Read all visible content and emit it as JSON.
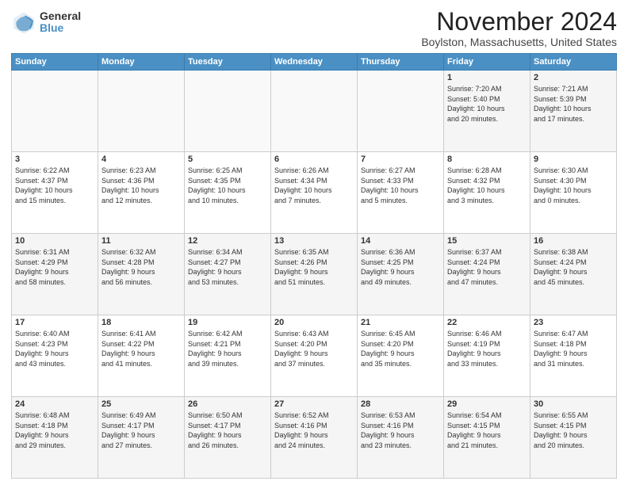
{
  "logo": {
    "general": "General",
    "blue": "Blue"
  },
  "title": "November 2024",
  "location": "Boylston, Massachusetts, United States",
  "days_header": [
    "Sunday",
    "Monday",
    "Tuesday",
    "Wednesday",
    "Thursday",
    "Friday",
    "Saturday"
  ],
  "weeks": [
    [
      {
        "day": "",
        "info": ""
      },
      {
        "day": "",
        "info": ""
      },
      {
        "day": "",
        "info": ""
      },
      {
        "day": "",
        "info": ""
      },
      {
        "day": "",
        "info": ""
      },
      {
        "day": "1",
        "info": "Sunrise: 7:20 AM\nSunset: 5:40 PM\nDaylight: 10 hours\nand 20 minutes."
      },
      {
        "day": "2",
        "info": "Sunrise: 7:21 AM\nSunset: 5:39 PM\nDaylight: 10 hours\nand 17 minutes."
      }
    ],
    [
      {
        "day": "3",
        "info": "Sunrise: 6:22 AM\nSunset: 4:37 PM\nDaylight: 10 hours\nand 15 minutes."
      },
      {
        "day": "4",
        "info": "Sunrise: 6:23 AM\nSunset: 4:36 PM\nDaylight: 10 hours\nand 12 minutes."
      },
      {
        "day": "5",
        "info": "Sunrise: 6:25 AM\nSunset: 4:35 PM\nDaylight: 10 hours\nand 10 minutes."
      },
      {
        "day": "6",
        "info": "Sunrise: 6:26 AM\nSunset: 4:34 PM\nDaylight: 10 hours\nand 7 minutes."
      },
      {
        "day": "7",
        "info": "Sunrise: 6:27 AM\nSunset: 4:33 PM\nDaylight: 10 hours\nand 5 minutes."
      },
      {
        "day": "8",
        "info": "Sunrise: 6:28 AM\nSunset: 4:32 PM\nDaylight: 10 hours\nand 3 minutes."
      },
      {
        "day": "9",
        "info": "Sunrise: 6:30 AM\nSunset: 4:30 PM\nDaylight: 10 hours\nand 0 minutes."
      }
    ],
    [
      {
        "day": "10",
        "info": "Sunrise: 6:31 AM\nSunset: 4:29 PM\nDaylight: 9 hours\nand 58 minutes."
      },
      {
        "day": "11",
        "info": "Sunrise: 6:32 AM\nSunset: 4:28 PM\nDaylight: 9 hours\nand 56 minutes."
      },
      {
        "day": "12",
        "info": "Sunrise: 6:34 AM\nSunset: 4:27 PM\nDaylight: 9 hours\nand 53 minutes."
      },
      {
        "day": "13",
        "info": "Sunrise: 6:35 AM\nSunset: 4:26 PM\nDaylight: 9 hours\nand 51 minutes."
      },
      {
        "day": "14",
        "info": "Sunrise: 6:36 AM\nSunset: 4:25 PM\nDaylight: 9 hours\nand 49 minutes."
      },
      {
        "day": "15",
        "info": "Sunrise: 6:37 AM\nSunset: 4:24 PM\nDaylight: 9 hours\nand 47 minutes."
      },
      {
        "day": "16",
        "info": "Sunrise: 6:38 AM\nSunset: 4:24 PM\nDaylight: 9 hours\nand 45 minutes."
      }
    ],
    [
      {
        "day": "17",
        "info": "Sunrise: 6:40 AM\nSunset: 4:23 PM\nDaylight: 9 hours\nand 43 minutes."
      },
      {
        "day": "18",
        "info": "Sunrise: 6:41 AM\nSunset: 4:22 PM\nDaylight: 9 hours\nand 41 minutes."
      },
      {
        "day": "19",
        "info": "Sunrise: 6:42 AM\nSunset: 4:21 PM\nDaylight: 9 hours\nand 39 minutes."
      },
      {
        "day": "20",
        "info": "Sunrise: 6:43 AM\nSunset: 4:20 PM\nDaylight: 9 hours\nand 37 minutes."
      },
      {
        "day": "21",
        "info": "Sunrise: 6:45 AM\nSunset: 4:20 PM\nDaylight: 9 hours\nand 35 minutes."
      },
      {
        "day": "22",
        "info": "Sunrise: 6:46 AM\nSunset: 4:19 PM\nDaylight: 9 hours\nand 33 minutes."
      },
      {
        "day": "23",
        "info": "Sunrise: 6:47 AM\nSunset: 4:18 PM\nDaylight: 9 hours\nand 31 minutes."
      }
    ],
    [
      {
        "day": "24",
        "info": "Sunrise: 6:48 AM\nSunset: 4:18 PM\nDaylight: 9 hours\nand 29 minutes."
      },
      {
        "day": "25",
        "info": "Sunrise: 6:49 AM\nSunset: 4:17 PM\nDaylight: 9 hours\nand 27 minutes."
      },
      {
        "day": "26",
        "info": "Sunrise: 6:50 AM\nSunset: 4:17 PM\nDaylight: 9 hours\nand 26 minutes."
      },
      {
        "day": "27",
        "info": "Sunrise: 6:52 AM\nSunset: 4:16 PM\nDaylight: 9 hours\nand 24 minutes."
      },
      {
        "day": "28",
        "info": "Sunrise: 6:53 AM\nSunset: 4:16 PM\nDaylight: 9 hours\nand 23 minutes."
      },
      {
        "day": "29",
        "info": "Sunrise: 6:54 AM\nSunset: 4:15 PM\nDaylight: 9 hours\nand 21 minutes."
      },
      {
        "day": "30",
        "info": "Sunrise: 6:55 AM\nSunset: 4:15 PM\nDaylight: 9 hours\nand 20 minutes."
      }
    ]
  ]
}
